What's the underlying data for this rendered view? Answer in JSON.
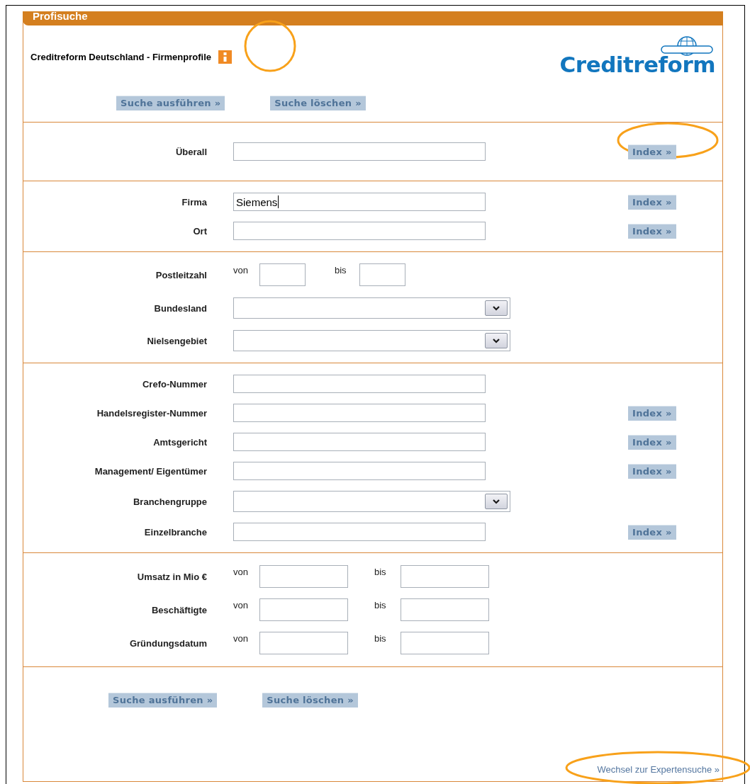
{
  "panel": {
    "title": "Profisuche"
  },
  "header": {
    "heading": "Creditreform Deutschland - Firmenprofile",
    "logo": "Creditreform"
  },
  "top_buttons": [
    "Suche ausführen »",
    "Suche löschen »"
  ],
  "sections": [
    {
      "fields": [
        {
          "kind": "text",
          "label": "Überall",
          "focused": false,
          "index_button": "Index »"
        }
      ]
    },
    {
      "fields": [
        {
          "kind": "text",
          "label": "Firma",
          "value": "Siemens",
          "focused": true,
          "index_button": "Index »"
        },
        {
          "kind": "text",
          "label": "Ort",
          "focused": false,
          "index_button": "Index »"
        }
      ]
    },
    {
      "fields": [
        {
          "kind": "short_range",
          "label": "Postleitzahl",
          "from_label": "von",
          "to_label": "bis"
        },
        {
          "kind": "select",
          "label": "Bundesland"
        },
        {
          "kind": "select",
          "label": "Nielsengebiet"
        }
      ]
    },
    {
      "fields": [
        {
          "kind": "text",
          "label": "Crefo-Nummer",
          "focused": false
        },
        {
          "kind": "text",
          "label": "Handelsregister-Nummer",
          "focused": false,
          "index_button": "Index »"
        },
        {
          "kind": "text",
          "label": "Amtsgericht",
          "focused": false,
          "index_button": "Index »"
        },
        {
          "kind": "text",
          "label": "Management/ Eigentümer",
          "focused": false,
          "index_button": "Index »"
        },
        {
          "kind": "select",
          "label": "Branchengruppe"
        },
        {
          "kind": "text",
          "label": "Einzelbranche",
          "focused": false,
          "index_button": "Index »"
        }
      ]
    },
    {
      "fields": [
        {
          "kind": "range",
          "label": "Umsatz in Mio €",
          "from_label": "von",
          "to_label": "bis"
        },
        {
          "kind": "range",
          "label": "Beschäftigte",
          "from_label": "von",
          "to_label": "bis"
        },
        {
          "kind": "range",
          "label": "Gründungsdatum",
          "from_label": "von",
          "to_label": "bis"
        }
      ]
    }
  ],
  "bottom_buttons": [
    "Suche ausführen »",
    "Suche löschen »"
  ],
  "footer_link": "Wechsel zur Expertensuche »"
}
